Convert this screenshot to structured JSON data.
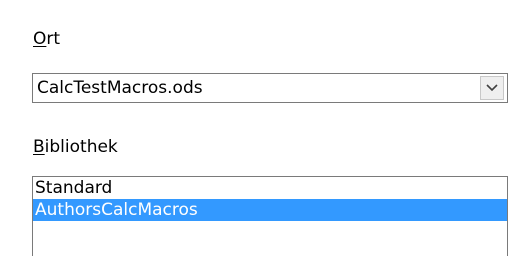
{
  "location": {
    "label_mnemonic": "O",
    "label_rest": "rt",
    "value": "CalcTestMacros.ods",
    "dropdown_icon": "chevron-down-icon"
  },
  "library": {
    "label_mnemonic": "B",
    "label_rest": "ibliothek",
    "items": [
      {
        "label": "Standard",
        "selected": false
      },
      {
        "label": "AuthorsCalcMacros",
        "selected": true
      }
    ]
  },
  "colors": {
    "selection_background": "#3399ff",
    "selection_text": "#ffffff",
    "border": "#7a7a7a"
  }
}
